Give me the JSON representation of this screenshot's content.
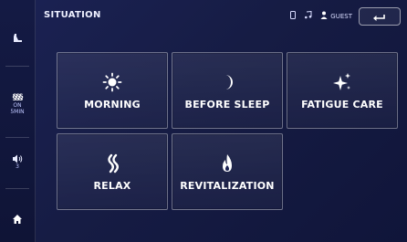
{
  "header": {
    "title": "SITUATION",
    "status": {
      "user_label": "GUEST"
    }
  },
  "rail": {
    "lumbar": {
      "label": "§§§",
      "state": "ON",
      "sub": "5MIN"
    },
    "volume": {
      "label": "3"
    }
  },
  "tiles": [
    {
      "label": "MORNING",
      "icon": "sun-icon"
    },
    {
      "label": "BEFORE SLEEP",
      "icon": "moon-icon"
    },
    {
      "label": "FATIGUE CARE",
      "icon": "sparkle-icon"
    },
    {
      "label": "RELAX",
      "icon": "waves-icon"
    },
    {
      "label": "REVITALIZATION",
      "icon": "flame-icon"
    }
  ],
  "colors": {
    "background": "#161c44",
    "tile_border": "#8a90c0",
    "text": "#ffffff"
  }
}
